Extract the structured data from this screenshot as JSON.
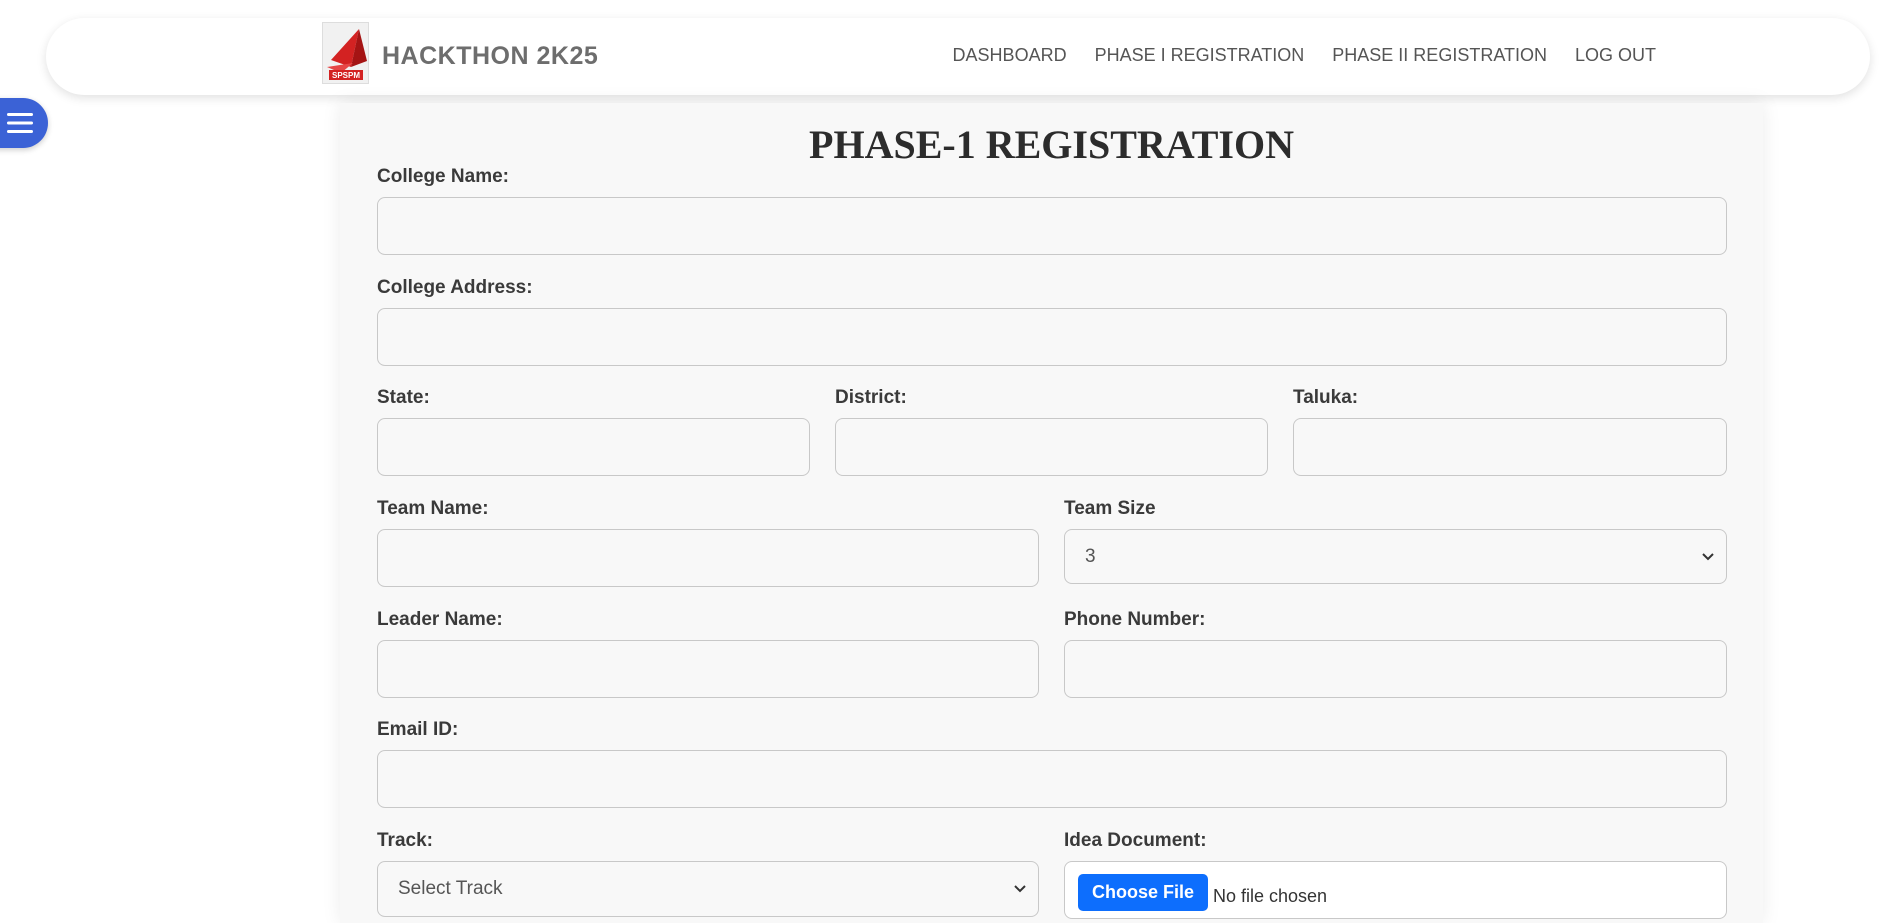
{
  "header": {
    "brand_title": "HACKTHON 2K25",
    "logo_text": "SPSPM",
    "nav": [
      {
        "label": "DASHBOARD"
      },
      {
        "label": "PHASE I REGISTRATION"
      },
      {
        "label": "PHASE II REGISTRATION"
      },
      {
        "label": "LOG OUT"
      }
    ]
  },
  "form": {
    "title": "PHASE-1 REGISTRATION",
    "college_name_label": "College Name:",
    "college_address_label": "College Address:",
    "state_label": "State:",
    "district_label": "District:",
    "taluka_label": "Taluka:",
    "team_name_label": "Team Name:",
    "team_size_label": "Team Size",
    "team_size_value": "3",
    "leader_name_label": "Leader Name:",
    "phone_label": "Phone Number:",
    "email_label": "Email ID:",
    "track_label": "Track:",
    "track_value": "Select Track",
    "idea_doc_label": "Idea Document:",
    "choose_file_label": "Choose File",
    "no_file_text": "No file chosen"
  },
  "colors": {
    "accent": "#0d6efd",
    "menu_toggle": "#3b62d6",
    "logo_red": "#d32222"
  }
}
